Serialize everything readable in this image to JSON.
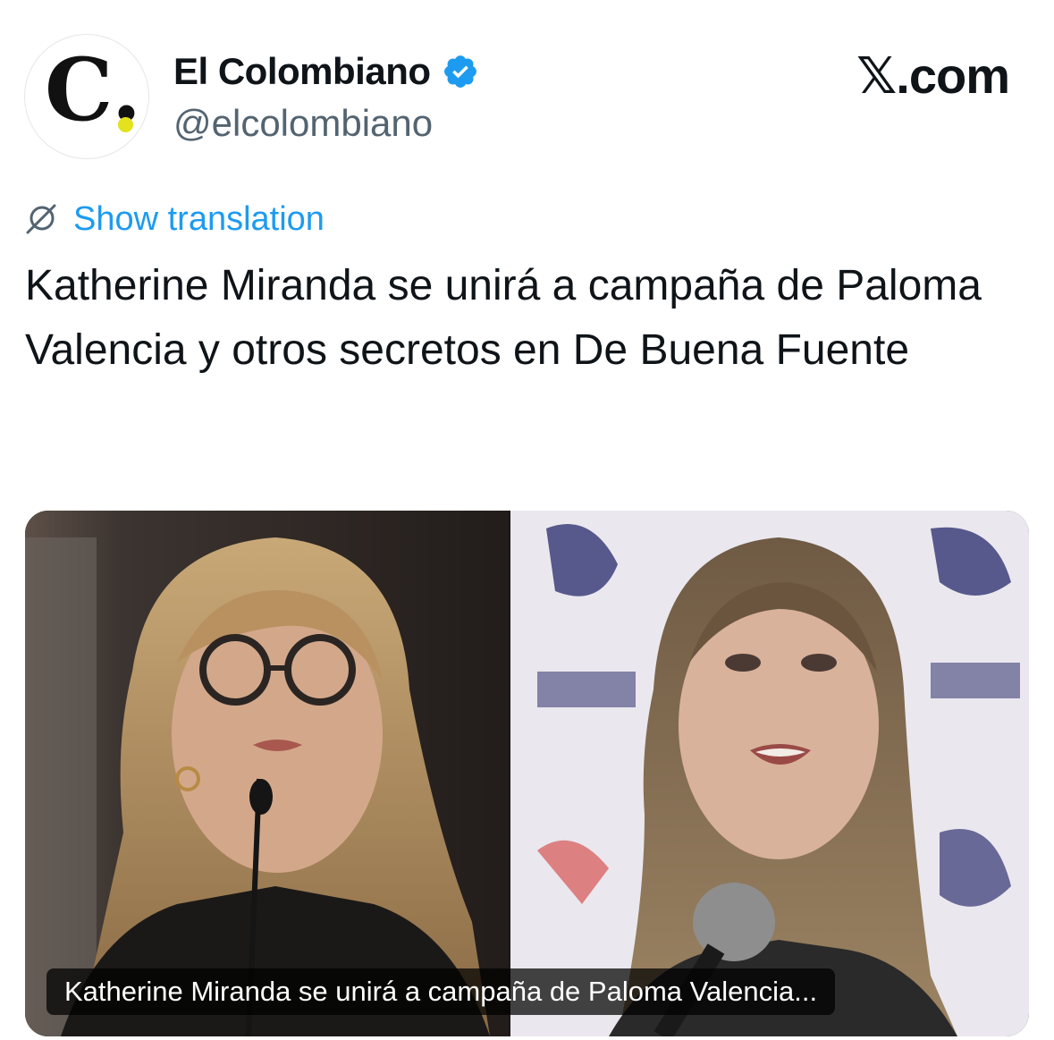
{
  "account": {
    "display_name": "El Colombiano",
    "handle": "@elcolombiano",
    "verified": true,
    "avatar_letter": "C.",
    "avatar_icon": "el-colombiano-logo",
    "verified_icon": "verified-badge-icon"
  },
  "brand": {
    "watermark": "𝕏.com"
  },
  "translation": {
    "label": "Show translation",
    "icon": "translate-globe-icon"
  },
  "tweet": {
    "text": "Katherine Miranda se unirá a campaña de Paloma Valencia y otros secretos en De Buena Fuente"
  },
  "media": {
    "caption": "Katherine Miranda se unirá a campaña de Paloma Valencia..."
  },
  "colors": {
    "link_blue": "#1d9bf0",
    "handle_gray": "#536471",
    "text": "#0f1419",
    "logo_dot_yellow": "#e4e11d"
  }
}
